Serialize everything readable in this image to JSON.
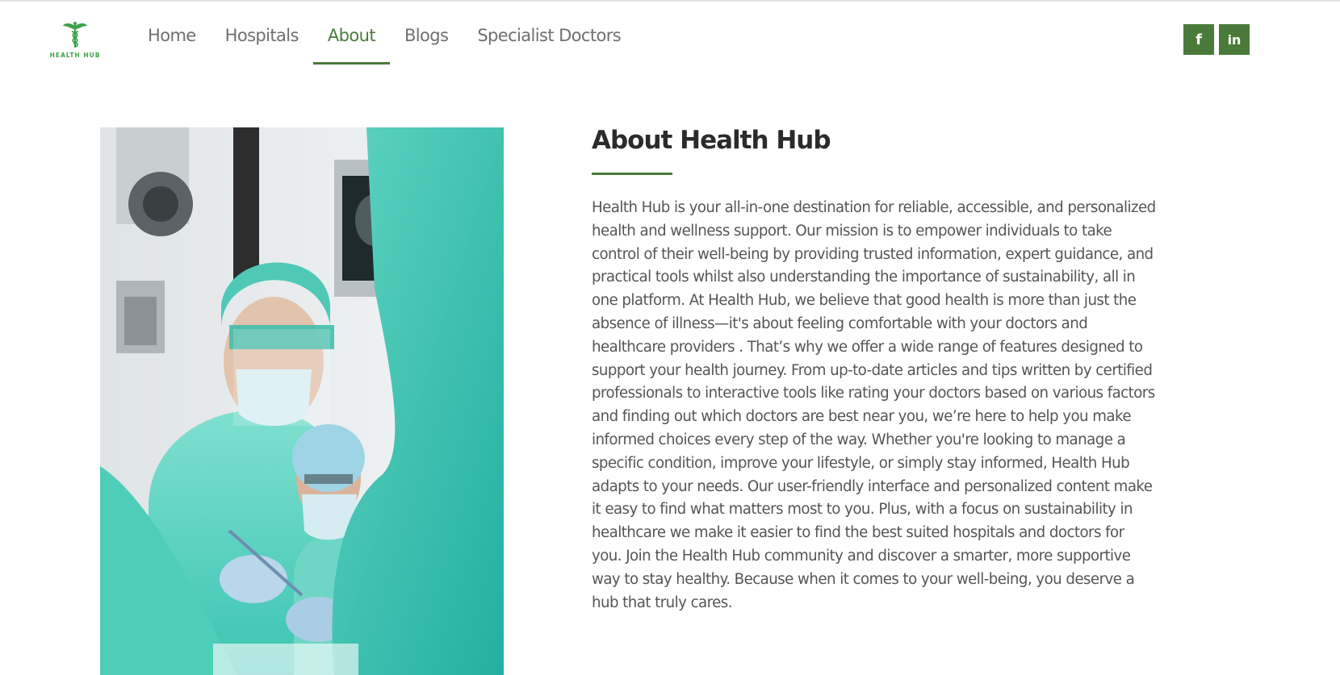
{
  "logo": {
    "text": "HEALTH HUB",
    "icon": "caduceus-icon",
    "color": "#3fa24a"
  },
  "nav": {
    "items": [
      {
        "label": "Home",
        "active": false
      },
      {
        "label": "Hospitals",
        "active": false
      },
      {
        "label": "About",
        "active": true
      },
      {
        "label": "Blogs",
        "active": false
      },
      {
        "label": "Specialist Doctors",
        "active": false
      }
    ],
    "accent": "#4a7a3a"
  },
  "social": {
    "facebook": {
      "glyph": "f",
      "icon": "facebook-icon"
    },
    "linkedin": {
      "glyph": "in",
      "icon": "linkedin-icon"
    }
  },
  "hero_image": {
    "icon": "surgeons-photo"
  },
  "about": {
    "title": "About Health Hub",
    "body": "Health Hub is your all-in-one destination for reliable, accessible, and personalized health and wellness support. Our mission is to empower individuals to take control of their well-being by providing trusted information, expert guidance, and practical tools whilst also understanding the importance of sustainability, all in one platform. At Health Hub, we believe that good health is more than just the absence of illness—it's about feeling comfortable with your doctors and healthcare providers . That’s why we offer a wide range of features designed to support your health journey. From up-to-date articles and tips written by certified professionals to interactive tools like rating your doctors based on various factors and finding out which doctors are best near you, we’re here to help you make informed choices every step of the way. Whether you're looking to manage a specific condition, improve your lifestyle, or simply stay informed, Health Hub adapts to your needs. Our user-friendly interface and personalized content make it easy to find what matters most to you. Plus, with a focus on sustainability in healthcare we make it easier to find the best suited hospitals and doctors for you. Join the Health Hub community and discover a smarter, more supportive way to stay healthy. Because when it comes to your well-being, you deserve a hub that truly cares."
  }
}
